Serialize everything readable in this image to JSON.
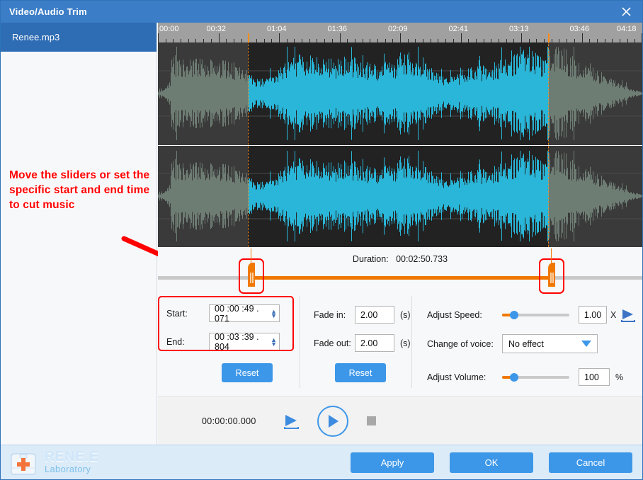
{
  "window": {
    "title": "Video/Audio Trim",
    "close_icon": "close-icon"
  },
  "sidebar": {
    "files": [
      {
        "name": "Renee.mp3",
        "selected": true
      }
    ],
    "annotation": "Move the sliders or set the specific start and end time to cut music"
  },
  "timeline": {
    "ticks": [
      "00:00",
      "00:32",
      "01:04",
      "01:36",
      "02:09",
      "02:41",
      "03:13",
      "03:46",
      "04:18"
    ],
    "selection_start_pct": 18.6,
    "selection_end_pct": 80.6
  },
  "trim": {
    "duration_label": "Duration:",
    "duration_value": "00:02:50.733",
    "start_label": "Start:",
    "start_value": "00 :00 :49 . 071",
    "end_label": "End:",
    "end_value": "00 :03 :39 . 804",
    "reset_label": "Reset"
  },
  "fade": {
    "fade_in_label": "Fade in:",
    "fade_in_value": "2.00",
    "fade_in_unit": "(s)",
    "fade_out_label": "Fade out:",
    "fade_out_value": "2.00",
    "fade_out_unit": "(s)",
    "reset_label": "Reset"
  },
  "effects": {
    "speed_label": "Adjust Speed:",
    "speed_value": "1.00",
    "speed_unit": "X",
    "speed_preview_icon": "play-preview-icon",
    "voice_label": "Change of voice:",
    "voice_value": "No effect",
    "voice_dropdown_icon": "chevron-down-icon",
    "volume_label": "Adjust Volume:",
    "volume_value": "100",
    "volume_unit": "%"
  },
  "player": {
    "current_time": "00:00:00.000",
    "preview_icon": "play-preview-icon",
    "play_icon": "play-icon",
    "stop_icon": "stop-icon"
  },
  "footer": {
    "logo_main": "RENE.E",
    "logo_sub": "Laboratory",
    "logo_icon": "medical-bag-icon",
    "apply_label": "Apply",
    "ok_label": "OK",
    "cancel_label": "Cancel"
  },
  "colors": {
    "title_bar": "#3b7dc6",
    "accent_blue": "#3d97e8",
    "selected_item": "#2e6cb3",
    "waveform_selected": "#29b6d8",
    "waveform_unselected": "#6e7d74",
    "slider_orange": "#f07800",
    "annotation_red": "#ff0000",
    "footer_bg": "#dcebf8"
  }
}
